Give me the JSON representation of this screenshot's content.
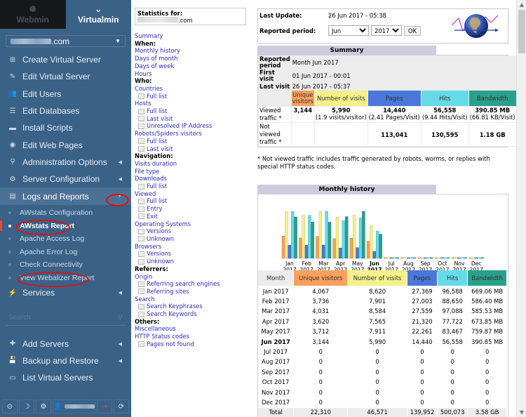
{
  "sidebar": {
    "tabs": [
      {
        "label": "Webmin",
        "icon": "webmin-icon"
      },
      {
        "label": "Virtualmin",
        "icon": "chevron-down-icon"
      }
    ],
    "domain_suffix": ".com",
    "menu": [
      {
        "label": "Create Virtual Server",
        "icon": "⊞",
        "arrow": ""
      },
      {
        "label": "Edit Virtual Server",
        "icon": "✎",
        "arrow": ""
      },
      {
        "label": "Edit Users",
        "icon": "👥",
        "arrow": ""
      },
      {
        "label": "Edit Databases",
        "icon": "☰",
        "arrow": ""
      },
      {
        "label": "Install Scripts",
        "icon": "▬",
        "arrow": ""
      },
      {
        "label": "Edit Web Pages",
        "icon": "◉",
        "arrow": ""
      },
      {
        "label": "Administration Options",
        "icon": "⚲",
        "arrow": "◀"
      },
      {
        "label": "Server Configuration",
        "icon": "⚙",
        "arrow": "◀"
      },
      {
        "label": "Logs and Reports",
        "icon": "▤",
        "arrow": "▼"
      }
    ],
    "submenu": [
      {
        "label": "AWstats Configuration"
      },
      {
        "label": "AWstats Report"
      },
      {
        "label": "Apache Access Log"
      },
      {
        "label": "Apache Error Log"
      },
      {
        "label": "Check Connectivity"
      },
      {
        "label": "View Webalizer Report"
      }
    ],
    "services": {
      "label": "Services",
      "icon": "⚡",
      "arrow": "◀"
    },
    "search_placeholder": "Search",
    "bottom_menu": [
      {
        "label": "Add Servers",
        "icon": "✚",
        "arrow": "◀"
      },
      {
        "label": "Backup and Restore",
        "icon": "💾",
        "arrow": "◀"
      },
      {
        "label": "List Virtual Servers",
        "icon": "▭",
        "arrow": ""
      }
    ],
    "footer": [
      "⊙",
      "☽",
      "⚙",
      "👤",
      "⇥",
      "⟳"
    ]
  },
  "awnav": {
    "stats_for_label": "Statistics for:",
    "domain_suffix": ".com",
    "links": [
      {
        "t": "link",
        "label": "Summary"
      },
      {
        "t": "head",
        "label": "When:"
      },
      {
        "t": "link",
        "label": "Monthly history"
      },
      {
        "t": "link",
        "label": "Days of month"
      },
      {
        "t": "link",
        "label": "Days of week"
      },
      {
        "t": "link",
        "label": "Hours"
      },
      {
        "t": "head",
        "label": "Who:"
      },
      {
        "t": "link",
        "label": "Countries"
      },
      {
        "t": "sub",
        "label": "Full list"
      },
      {
        "t": "link",
        "label": "Hosts"
      },
      {
        "t": "sub",
        "label": "Full list"
      },
      {
        "t": "sub",
        "label": "Last visit"
      },
      {
        "t": "sub",
        "label": "Unresolved IP Address"
      },
      {
        "t": "link",
        "label": "Robots/Spiders visitors"
      },
      {
        "t": "sub",
        "label": "Full list"
      },
      {
        "t": "sub",
        "label": "Last visit"
      },
      {
        "t": "head",
        "label": "Navigation:"
      },
      {
        "t": "link",
        "label": "Visits duration"
      },
      {
        "t": "link",
        "label": "File type"
      },
      {
        "t": "link",
        "label": "Downloads"
      },
      {
        "t": "sub",
        "label": "Full list"
      },
      {
        "t": "link",
        "label": "Viewed"
      },
      {
        "t": "sub",
        "label": "Full list"
      },
      {
        "t": "sub",
        "label": "Entry"
      },
      {
        "t": "sub",
        "label": "Exit"
      },
      {
        "t": "link",
        "label": "Operating Systems"
      },
      {
        "t": "sub",
        "label": "Versions"
      },
      {
        "t": "sub",
        "label": "Unknown"
      },
      {
        "t": "link",
        "label": "Browsers"
      },
      {
        "t": "sub",
        "label": "Versions"
      },
      {
        "t": "sub",
        "label": "Unknown"
      },
      {
        "t": "head",
        "label": "Referrers:"
      },
      {
        "t": "link",
        "label": "Origin"
      },
      {
        "t": "sub",
        "label": "Referring search engines"
      },
      {
        "t": "sub",
        "label": "Referring sites"
      },
      {
        "t": "link",
        "label": "Search"
      },
      {
        "t": "sub",
        "label": "Search Keyphrases"
      },
      {
        "t": "sub",
        "label": "Search Keywords"
      },
      {
        "t": "head",
        "label": "Others:"
      },
      {
        "t": "link",
        "label": "Miscellaneous"
      },
      {
        "t": "link",
        "label": "HTTP Status codes"
      },
      {
        "t": "sub",
        "label": "Pages not found"
      }
    ]
  },
  "header": {
    "last_update_label": "Last Update:",
    "last_update_value": "26 Jun 2017 - 05:38",
    "period_label": "Reported period:",
    "month": "Jun",
    "year": "2017",
    "ok_label": "OK"
  },
  "summary": {
    "title": "Summary",
    "reported_period_label": "Reported period",
    "reported_period_value": "Month Jun 2017",
    "first_visit_label": "First visit",
    "first_visit_value": "01 Jun 2017 - 00:01",
    "last_visit_label": "Last visit",
    "last_visit_value": "26 Jun 2017 - 05:37",
    "columns": [
      "Unique visitors",
      "Number of visits",
      "Pages",
      "Hits",
      "Bandwidth"
    ],
    "viewed_label": "Viewed traffic *",
    "viewed": [
      "3,144",
      "5,990",
      "14,440",
      "56,558",
      "390.85 MB"
    ],
    "viewed_sub": [
      "",
      "(1.9 visits/visitor)",
      "(2.41 Pages/Visit)",
      "(9.44 Hits/Visit)",
      "(66.81 KB/Visit)"
    ],
    "not_viewed_label": "Not viewed traffic *",
    "not_viewed": [
      "",
      "",
      "113,041",
      "130,595",
      "1.18 GB"
    ],
    "note": "* Not viewed traffic includes traffic generated by robots, worms, or replies with special HTTP status codes."
  },
  "colors": {
    "unique": "#f9a05d",
    "visits": "#f4f08a",
    "pages": "#4a77da",
    "hits": "#66dbe8",
    "bandwidth": "#2aa08a"
  },
  "monthly": {
    "title": "Monthly history",
    "columns": [
      "Month",
      "Unique visitors",
      "Number of visits",
      "Pages",
      "Hits",
      "Bandwidth"
    ],
    "rows": [
      [
        "Jan 2017",
        "4,067",
        "8,620",
        "27,369",
        "96,588",
        "669.06 MB"
      ],
      [
        "Feb 2017",
        "3,736",
        "7,901",
        "27,003",
        "88,650",
        "586.40 MB"
      ],
      [
        "Mar 2017",
        "4,031",
        "8,584",
        "27,559",
        "97,088",
        "585.53 MB"
      ],
      [
        "Apr 2017",
        "3,620",
        "7,565",
        "21,320",
        "77,722",
        "673.85 MB"
      ],
      [
        "May 2017",
        "3,712",
        "7,911",
        "22,261",
        "83,467",
        "759.87 MB"
      ],
      [
        "Jun 2017",
        "3,144",
        "5,990",
        "14,440",
        "56,558",
        "390.85 MB"
      ],
      [
        "Jul 2017",
        "0",
        "0",
        "0",
        "0",
        "0"
      ],
      [
        "Aug 2017",
        "0",
        "0",
        "0",
        "0",
        "0"
      ],
      [
        "Sep 2017",
        "0",
        "0",
        "0",
        "0",
        "0"
      ],
      [
        "Oct 2017",
        "0",
        "0",
        "0",
        "0",
        "0"
      ],
      [
        "Nov 2017",
        "0",
        "0",
        "0",
        "0",
        "0"
      ],
      [
        "Dec 2017",
        "0",
        "0",
        "0",
        "0",
        "0"
      ]
    ],
    "total": [
      "Total",
      "22,310",
      "46,571",
      "139,952",
      "500,073",
      "3.58 GB"
    ],
    "current_month_index": 5
  },
  "chart_data": {
    "type": "bar",
    "title": "Monthly history",
    "categories": [
      "Jan",
      "Feb",
      "Mar",
      "Apr",
      "May",
      "Jun",
      "Jul",
      "Aug",
      "Sep",
      "Oct",
      "Nov",
      "Dec"
    ],
    "category_years": [
      "2017",
      "2017",
      "2017",
      "2017",
      "2017",
      "2017",
      "2017",
      "2017",
      "2017",
      "2017",
      "2017",
      "2017"
    ],
    "series": [
      {
        "name": "Unique visitors",
        "values": [
          4067,
          3736,
          4031,
          3620,
          3712,
          3144,
          0,
          0,
          0,
          0,
          0,
          0
        ]
      },
      {
        "name": "Number of visits",
        "values": [
          8620,
          7901,
          8584,
          7565,
          7911,
          5990,
          0,
          0,
          0,
          0,
          0,
          0
        ]
      },
      {
        "name": "Pages",
        "values": [
          27369,
          27003,
          27559,
          21320,
          22261,
          14440,
          0,
          0,
          0,
          0,
          0,
          0
        ]
      },
      {
        "name": "Hits",
        "values": [
          96588,
          88650,
          97088,
          77722,
          83467,
          56558,
          0,
          0,
          0,
          0,
          0,
          0
        ]
      },
      {
        "name": "Bandwidth (MB)",
        "values": [
          669.06,
          586.4,
          585.53,
          673.85,
          759.87,
          390.85,
          0,
          0,
          0,
          0,
          0,
          0
        ]
      }
    ],
    "xlabel": "",
    "ylabel": "",
    "grid": false,
    "legend": "none"
  }
}
